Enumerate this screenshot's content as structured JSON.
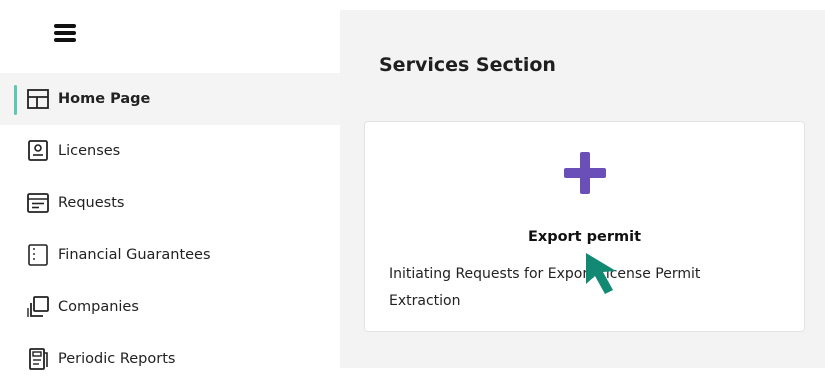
{
  "sidebar": {
    "menu_icon": "hamburger-menu-icon",
    "items": [
      {
        "label": "Home Page",
        "icon": "layout-icon",
        "active": true
      },
      {
        "label": "Licenses",
        "icon": "license-card-icon",
        "active": false
      },
      {
        "label": "Requests",
        "icon": "requests-icon",
        "active": false
      },
      {
        "label": "Financial Guarantees",
        "icon": "guarantee-icon",
        "active": false
      },
      {
        "label": "Companies",
        "icon": "companies-icon",
        "active": false
      },
      {
        "label": "Periodic Reports",
        "icon": "reports-icon",
        "active": false
      }
    ]
  },
  "main": {
    "title": "Services Section",
    "card": {
      "icon": "plus-icon",
      "title": "Export permit",
      "description": "Initiating Requests for Export License Permit Extraction"
    }
  },
  "colors": {
    "accent": "#5cc7b2",
    "plus": "#6a4fb8",
    "cursor": "#128a73",
    "main_bg": "#f3f3f4"
  }
}
